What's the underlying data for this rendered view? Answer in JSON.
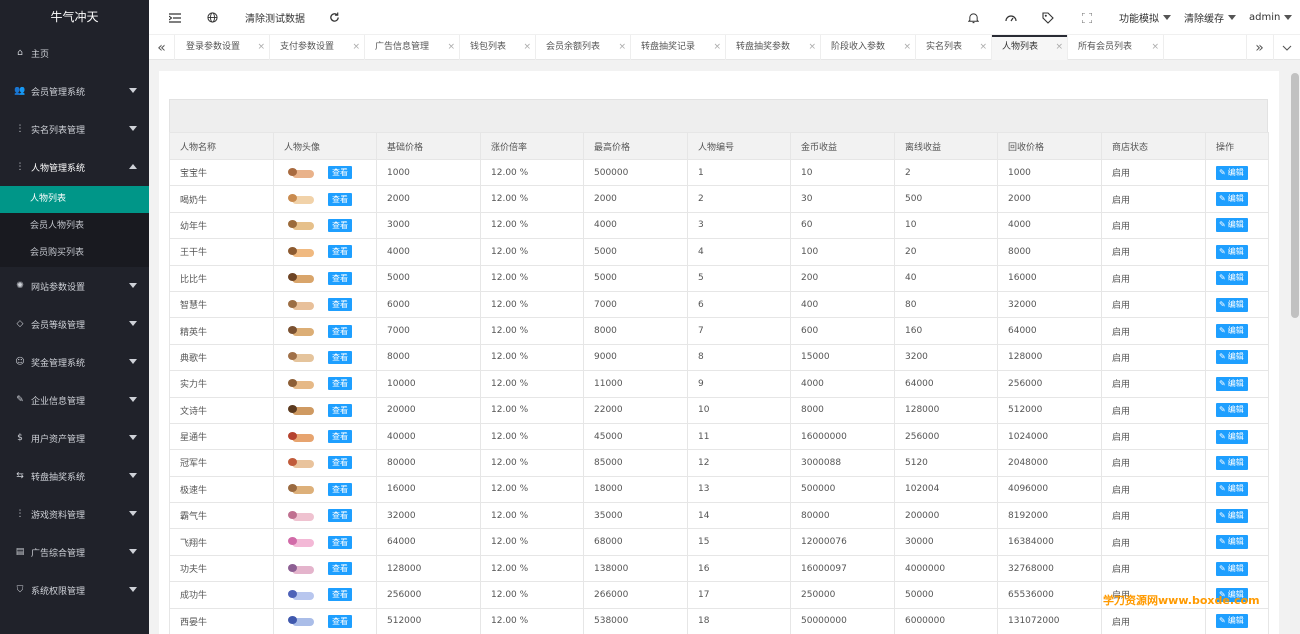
{
  "app": {
    "title": "牛气冲天"
  },
  "header": {
    "clear_test_data": "清除测试数据",
    "function_mode": "功能模拟",
    "clear_cache": "清除缓存",
    "user": "admin"
  },
  "sidebar": {
    "items": [
      {
        "label": "主页",
        "icon": "home-icon"
      },
      {
        "label": "会员管理系统",
        "icon": "users-icon"
      },
      {
        "label": "实名列表管理",
        "icon": "dots-icon"
      },
      {
        "label": "人物管理系统",
        "icon": "dots-icon",
        "open": true,
        "children": [
          {
            "label": "人物列表",
            "active": true
          },
          {
            "label": "会员人物列表"
          },
          {
            "label": "会员购买列表"
          }
        ]
      },
      {
        "label": "网站参数设置",
        "icon": "gear-icon"
      },
      {
        "label": "会员等级管理",
        "icon": "diamond-icon"
      },
      {
        "label": "奖金管理系统",
        "icon": "smile-icon"
      },
      {
        "label": "企业信息管理",
        "icon": "edit-icon"
      },
      {
        "label": "用户资产管理",
        "icon": "dollar-icon"
      },
      {
        "label": "转盘抽奖系统",
        "icon": "share-icon"
      },
      {
        "label": "游戏资料管理",
        "icon": "dots-icon"
      },
      {
        "label": "广告综合管理",
        "icon": "briefcase-icon"
      },
      {
        "label": "系统权限管理",
        "icon": "shield-icon"
      }
    ]
  },
  "tabs": [
    {
      "label": "登录参数设置",
      "w": 94
    },
    {
      "label": "支付参数设置",
      "w": 95
    },
    {
      "label": "广告信息管理",
      "w": 95
    },
    {
      "label": "钱包列表",
      "w": 76
    },
    {
      "label": "会员余额列表",
      "w": 95
    },
    {
      "label": "转盘抽奖记录",
      "w": 95
    },
    {
      "label": "转盘抽奖参数",
      "w": 95
    },
    {
      "label": "阶段收入参数",
      "w": 95
    },
    {
      "label": "实名列表",
      "w": 76
    },
    {
      "label": "人物列表",
      "w": 76,
      "active": true
    },
    {
      "label": "所有会员列表",
      "w": 96
    }
  ],
  "table": {
    "columns": [
      "人物名称",
      "人物头像",
      "基础价格",
      "涨价倍率",
      "最高价格",
      "人物编号",
      "金币收益",
      "离线收益",
      "回收价格",
      "商店状态",
      "操作"
    ],
    "view_label": "查看",
    "edit_label": "编辑",
    "rows": [
      [
        "宝宝牛",
        "1000",
        "12.00 %",
        "500000",
        "1",
        "10",
        "2",
        "1000",
        "启用"
      ],
      [
        "喝奶牛",
        "2000",
        "12.00 %",
        "2000",
        "2",
        "30",
        "500",
        "2000",
        "启用"
      ],
      [
        "幼年牛",
        "3000",
        "12.00 %",
        "4000",
        "3",
        "60",
        "10",
        "4000",
        "启用"
      ],
      [
        "王干牛",
        "4000",
        "12.00 %",
        "5000",
        "4",
        "100",
        "20",
        "8000",
        "启用"
      ],
      [
        "比比牛",
        "5000",
        "12.00 %",
        "5000",
        "5",
        "200",
        "40",
        "16000",
        "启用"
      ],
      [
        "智慧牛",
        "6000",
        "12.00 %",
        "7000",
        "6",
        "400",
        "80",
        "32000",
        "启用"
      ],
      [
        "精英牛",
        "7000",
        "12.00 %",
        "8000",
        "7",
        "600",
        "160",
        "64000",
        "启用"
      ],
      [
        "典歌牛",
        "8000",
        "12.00 %",
        "9000",
        "8",
        "15000",
        "3200",
        "128000",
        "启用"
      ],
      [
        "实力牛",
        "10000",
        "12.00 %",
        "11000",
        "9",
        "4000",
        "64000",
        "256000",
        "启用"
      ],
      [
        "文诗牛",
        "20000",
        "12.00 %",
        "22000",
        "10",
        "8000",
        "128000",
        "512000",
        "启用"
      ],
      [
        "星通牛",
        "40000",
        "12.00 %",
        "45000",
        "11",
        "16000000",
        "256000",
        "1024000",
        "启用"
      ],
      [
        "冠军牛",
        "80000",
        "12.00 %",
        "85000",
        "12",
        "3000088",
        "5120",
        "2048000",
        "启用"
      ],
      [
        "极速牛",
        "16000",
        "12.00 %",
        "18000",
        "13",
        "500000",
        "102004",
        "4096000",
        "启用"
      ],
      [
        "霸气牛",
        "32000",
        "12.00 %",
        "35000",
        "14",
        "80000",
        "200000",
        "8192000",
        "启用"
      ],
      [
        "飞翔牛",
        "64000",
        "12.00 %",
        "68000",
        "15",
        "12000076",
        "30000",
        "16384000",
        "启用"
      ],
      [
        "功夫牛",
        "128000",
        "12.00 %",
        "138000",
        "16",
        "16000097",
        "4000000",
        "32768000",
        "启用"
      ],
      [
        "成功牛",
        "256000",
        "12.00 %",
        "266000",
        "17",
        "250000",
        "50000",
        "65536000",
        "启用"
      ],
      [
        "西晏牛",
        "512000",
        "12.00 %",
        "538000",
        "18",
        "50000000",
        "6000000",
        "131072000",
        "启用"
      ]
    ]
  },
  "colors": {
    "sidebar_bg": "#20222a",
    "active": "#009688",
    "button": "#1e9fff"
  },
  "watermark": "学刀资源网www.boxde.com"
}
